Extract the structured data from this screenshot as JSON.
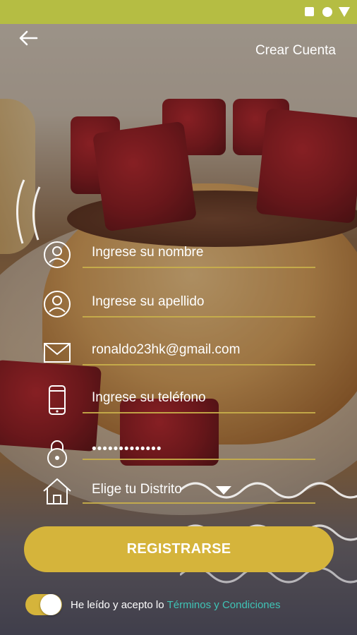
{
  "header": {
    "back_icon": "arrow-left-icon",
    "title": "Crear Cuenta"
  },
  "form": {
    "fields": [
      {
        "name": "nombre",
        "icon": "user-circle-icon",
        "value": "Ingrese su nombre"
      },
      {
        "name": "apellido",
        "icon": "user-circle-icon",
        "value": "Ingrese su apellido"
      },
      {
        "name": "email",
        "icon": "envelope-icon",
        "value": "ronaldo23hk@gmail.com"
      },
      {
        "name": "telefono",
        "icon": "mobile-phone-icon",
        "value": "Ingrese su teléfono"
      },
      {
        "name": "password",
        "icon": "padlock-icon",
        "value": "•••••••••••••"
      },
      {
        "name": "distrito",
        "icon": "home-icon",
        "value": "Elige tu Distrito"
      }
    ]
  },
  "register_label": "REGISTRARSE",
  "terms": {
    "text": "He leído y acepto lo",
    "link": "Términos y Condiciones",
    "accepted": true
  },
  "colors": {
    "status_bar": "#b5bd43",
    "accent": "#d5b43b",
    "link": "#3fc4b6"
  }
}
